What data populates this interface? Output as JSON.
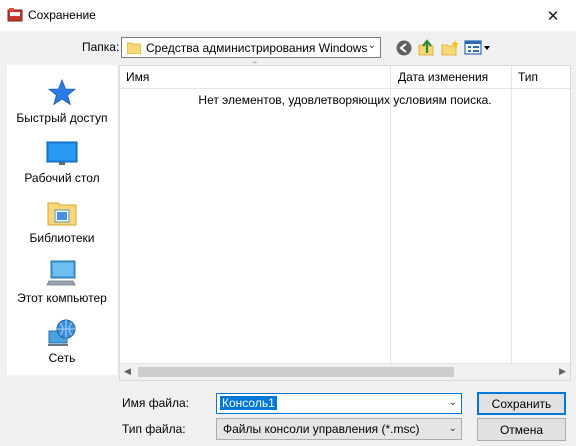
{
  "window": {
    "title": "Сохранение",
    "close": "✕"
  },
  "location": {
    "label": "Папка:",
    "value": "Средства администрирования Windows"
  },
  "toolbar": {
    "icons": [
      "back-icon",
      "up-folder-icon",
      "new-folder-icon",
      "view-menu-icon"
    ]
  },
  "places": [
    {
      "label": "Быстрый доступ",
      "icon": "star-icon"
    },
    {
      "label": "Рабочий стол",
      "icon": "desktop-icon"
    },
    {
      "label": "Библиотеки",
      "icon": "libraries-icon"
    },
    {
      "label": "Этот компьютер",
      "icon": "computer-icon"
    },
    {
      "label": "Сеть",
      "icon": "network-icon"
    }
  ],
  "list": {
    "columns": [
      "Имя",
      "Дата изменения",
      "Тип"
    ],
    "empty_message": "Нет элементов, удовлетворяющих условиям поиска."
  },
  "filename": {
    "label": "Имя файла:",
    "value": "Консоль1"
  },
  "filetype": {
    "label": "Тип файла:",
    "value": "Файлы консоли управления (*.msc)"
  },
  "buttons": {
    "save": "Сохранить",
    "cancel": "Отмена"
  },
  "colors": {
    "accent": "#0078d7",
    "star": "#2c7be5",
    "folder": "#f8d775"
  }
}
